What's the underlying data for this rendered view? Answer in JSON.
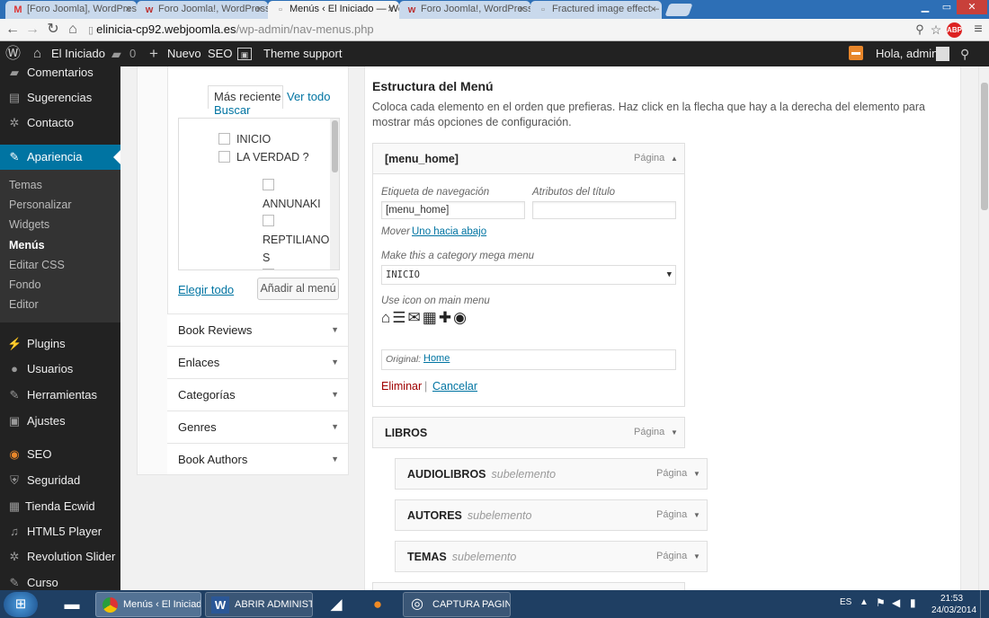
{
  "browser": {
    "tabs": [
      {
        "label": "[Foro Joomla], WordPress",
        "favicon": "gmail-icon",
        "active": false
      },
      {
        "label": "Foro Joomla!, WordPress",
        "favicon": "w-icon",
        "active": false
      },
      {
        "label": "Menús ‹ El Iniciado — Wo",
        "favicon": "page-icon",
        "active": true
      },
      {
        "label": "Foro Joomla!, WordPress",
        "favicon": "w-icon",
        "active": false
      },
      {
        "label": "Fractured image effect – F",
        "favicon": "page-icon",
        "active": false
      }
    ],
    "url_host": "elinicia-cp92.webjoomla.es",
    "url_path": "/wp-admin/nav-menus.php"
  },
  "adminbar": {
    "site_name": "El Iniciado",
    "comments_count": "0",
    "new_label": "Nuevo",
    "seo_label": "SEO",
    "theme_support": "Theme support",
    "greeting": "Hola, admin"
  },
  "sidebar": {
    "items": [
      {
        "label": "Comentarios",
        "icon": "comment-icon"
      },
      {
        "label": "Sugerencias",
        "icon": "inbox-icon"
      },
      {
        "label": "Contacto",
        "icon": "gear-icon"
      },
      {
        "label": "Apariencia",
        "icon": "brush-icon"
      },
      {
        "label": "Plugins",
        "icon": "plug-icon"
      },
      {
        "label": "Usuarios",
        "icon": "user-icon"
      },
      {
        "label": "Herramientas",
        "icon": "wrench-icon"
      },
      {
        "label": "Ajustes",
        "icon": "settings-icon"
      },
      {
        "label": "SEO",
        "icon": "seo-icon"
      },
      {
        "label": "Seguridad",
        "icon": "shield-icon"
      },
      {
        "label": "Tienda Ecwid",
        "icon": "cart-icon"
      },
      {
        "label": "HTML5 Player",
        "icon": "music-icon"
      },
      {
        "label": "Revolution Slider",
        "icon": "gear-icon"
      },
      {
        "label": "Curso",
        "icon": "book-icon"
      }
    ],
    "submenu": [
      "Temas",
      "Personalizar",
      "Widgets",
      "Menús",
      "Editar CSS",
      "Fondo",
      "Editor"
    ]
  },
  "left_panel": {
    "tab_recent": "Más reciente",
    "tab_all": "Ver todo",
    "tab_search": "Buscar",
    "pages": [
      "INICIO",
      "LA VERDAD ?",
      "ANNUNAKI",
      "REPTILIANO",
      "S"
    ],
    "select_all": "Elegir todo",
    "add_button": "Añadir al menú",
    "sections": [
      "Book Reviews",
      "Enlaces",
      "Categorías",
      "Genres",
      "Book Authors"
    ]
  },
  "menu_structure": {
    "heading": "Estructura del Menú",
    "description": "Coloca cada elemento en el orden que prefieras. Haz click en la flecha que hay a la derecha del elemento para mostrar más opciones de configuración.",
    "open_item": {
      "title": "[menu_home]",
      "type": "Página",
      "nav_label_label": "Etiqueta de navegación",
      "nav_label_value": "[menu_home]",
      "title_attr_label": "Atributos del título",
      "title_attr_value": "",
      "move_label": "Mover",
      "move_link": "Uno hacia abajo",
      "mega_label": "Make this a category mega menu",
      "mega_value": "INICIO",
      "icon_label": "Use icon on main menu",
      "icons": [
        "home-icon",
        "menu-icon",
        "mail-icon",
        "grid-icon",
        "plus-icon",
        "play-icon"
      ],
      "original_label": "Original:",
      "original_link": "Home",
      "delete_label": "Eliminar",
      "separator": "|",
      "cancel_label": "Cancelar"
    },
    "items": [
      {
        "title": "LIBROS",
        "sub": "",
        "type": "Página"
      },
      {
        "title": "AUDIOLIBROS",
        "sub": "subelemento",
        "type": "Página"
      },
      {
        "title": "AUTORES",
        "sub": "subelemento",
        "type": "Página"
      },
      {
        "title": "TEMAS",
        "sub": "subelemento",
        "type": "Página"
      }
    ]
  },
  "taskbar": {
    "buttons": [
      "Menús ‹ El Iniciad...",
      "ABRIR ADMINIST...",
      "CAPTURA PAGIN..."
    ],
    "lang": "ES",
    "time": "21:53",
    "date": "24/03/2014"
  },
  "colors": {
    "accent": "#0074a2",
    "sidebar_bg": "#222222",
    "taskbar_bg": "#1f3f63",
    "danger": "#a00000"
  }
}
